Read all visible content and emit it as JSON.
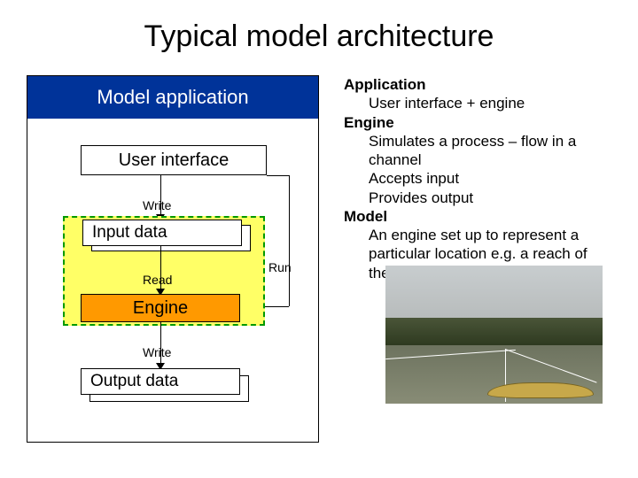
{
  "title": "Typical model architecture",
  "diagram": {
    "header": "Model application",
    "ui_box": "User interface",
    "write1": "Write",
    "input_box": "Input data",
    "read": "Read",
    "run": "Run",
    "engine": "Engine",
    "write2": "Write",
    "output_box": "Output data"
  },
  "defs": {
    "application_term": "Application",
    "application_desc": "User interface + engine",
    "engine_term": "Engine",
    "engine_desc1": "Simulates a process – flow in a channel",
    "engine_desc2": "Accepts input",
    "engine_desc3": "Provides output",
    "model_term": "Model",
    "model_desc": "An engine set up to represent a particular location e.g. a reach of the Thames"
  }
}
